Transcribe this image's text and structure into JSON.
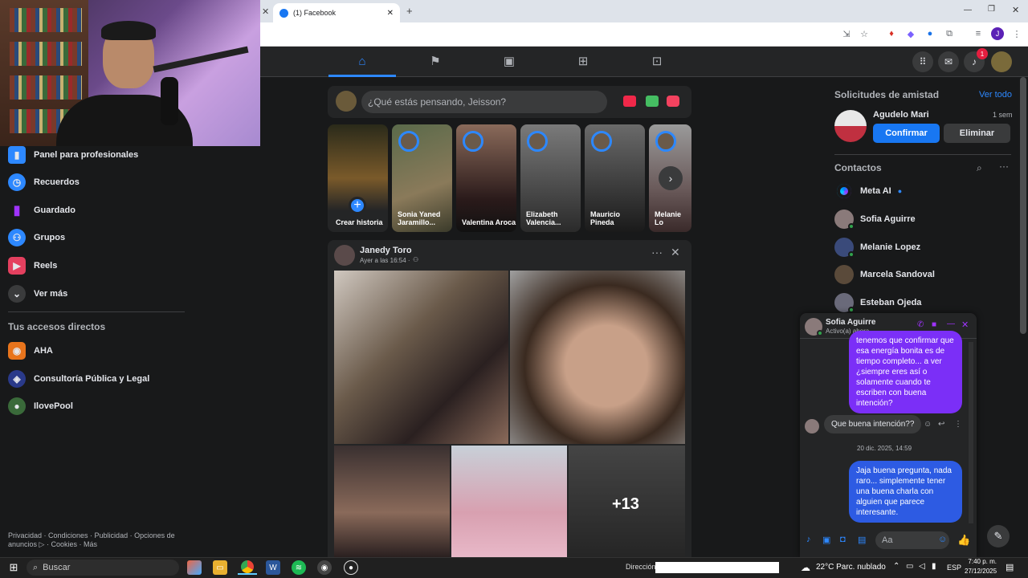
{
  "browser": {
    "tab_title": "(1) Facebook",
    "new_tab": "+",
    "ext_badge": "J"
  },
  "fb": {
    "notif_count": "1",
    "composer_placeholder": "¿Qué estás pensando, Jeisson?"
  },
  "sidebar": {
    "items": [
      {
        "label": "Panel para profesionales",
        "icon": "chart-icon",
        "color": "#2d88ff"
      },
      {
        "label": "Recuerdos",
        "icon": "clock-icon",
        "color": "#2d88ff"
      },
      {
        "label": "Guardado",
        "icon": "bookmark-icon",
        "color": "#a033ff"
      },
      {
        "label": "Grupos",
        "icon": "groups-icon",
        "color": "#2d88ff"
      },
      {
        "label": "Reels",
        "icon": "reels-icon",
        "color": "#e4405f"
      },
      {
        "label": "Ver más",
        "icon": "chevron-down-icon",
        "color": "#3a3b3c"
      }
    ],
    "shortcuts_title": "Tus accesos directos",
    "shortcuts": [
      {
        "label": "AHA"
      },
      {
        "label": "Consultoría Pública y Legal"
      },
      {
        "label": "IlovePool"
      }
    ],
    "footer": "Privacidad · Condiciones · Publicidad · Opciones de anuncios ▷ · Cookies · Más"
  },
  "stories": [
    {
      "label": "Crear historia",
      "plus": "+"
    },
    {
      "label": "Sonia Yaned Jaramillo..."
    },
    {
      "label": "Valentina Aroca"
    },
    {
      "label": "Elizabeth Valencia..."
    },
    {
      "label": "Mauricio Pineda"
    },
    {
      "label": "Melanie Lo"
    }
  ],
  "post": {
    "author": "Janedy Toro",
    "time": "Ayer a las 16:54 ·",
    "more_count": "+13"
  },
  "right": {
    "requests_title": "Solicitudes de amistad",
    "see_all": "Ver todo",
    "request_name": "Agudelo Mari",
    "request_time": "1 sem",
    "confirm": "Confirmar",
    "delete": "Eliminar",
    "contacts_title": "Contactos",
    "contacts": [
      {
        "name": "Meta AI"
      },
      {
        "name": "Sofia Aguirre"
      },
      {
        "name": "Melanie Lopez"
      },
      {
        "name": "Marcela Sandoval"
      },
      {
        "name": "Esteban Ojeda"
      }
    ]
  },
  "chat": {
    "name": "Sofia Aguirre",
    "status": "Activo(a) ahora",
    "msg1": "tenemos que confirmar que esa energía bonita es de tiempo completo... a ver ¿siempre eres así o solamente cuando te escriben con buena intención?",
    "msg2": "Que buena intención??",
    "date": "20 dic. 2025, 14:59",
    "msg3": "Jaja buena pregunta, nada raro... simplemente tener una buena charla con alguien que parece interesante.",
    "input_placeholder": "Aa"
  },
  "taskbar": {
    "search": "Buscar",
    "address_label": "Dirección",
    "weather": "22°C  Parc. nublado",
    "lang": "ESP",
    "time": "7:40 p. m.",
    "date": "27/12/2025"
  }
}
